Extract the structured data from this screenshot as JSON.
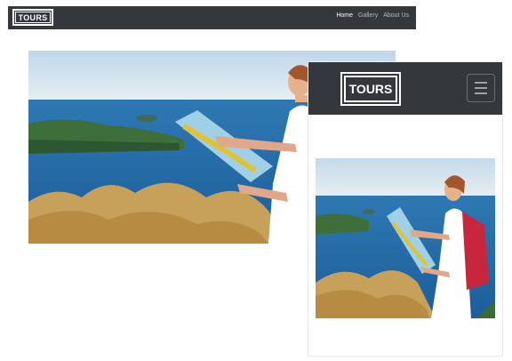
{
  "desktop": {
    "logo": "TOURS",
    "menu": [
      {
        "label": "Home"
      },
      {
        "label": "Gallery"
      },
      {
        "label": "About Us"
      }
    ]
  },
  "mobile": {
    "logo": "TOURS",
    "menu_toggle_icon": "hamburger-icon"
  },
  "images": {
    "hero_subject": "woman-reading-map-photo"
  }
}
